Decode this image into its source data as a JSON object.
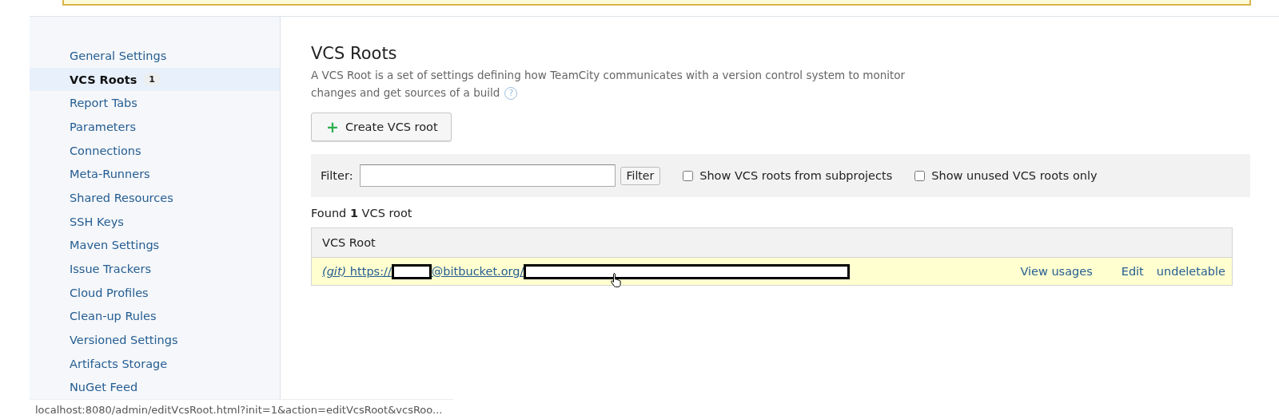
{
  "sidebar": {
    "items": [
      {
        "label": "General Settings",
        "selected": false
      },
      {
        "label": "VCS Roots",
        "selected": true,
        "count": "1"
      },
      {
        "label": "Report Tabs",
        "selected": false
      },
      {
        "label": "Parameters",
        "selected": false
      },
      {
        "label": "Connections",
        "selected": false
      },
      {
        "label": "Meta-Runners",
        "selected": false
      },
      {
        "label": "Shared Resources",
        "selected": false
      },
      {
        "label": "SSH Keys",
        "selected": false
      },
      {
        "label": "Maven Settings",
        "selected": false
      },
      {
        "label": "Issue Trackers",
        "selected": false
      },
      {
        "label": "Cloud Profiles",
        "selected": false
      },
      {
        "label": "Clean-up Rules",
        "selected": false
      },
      {
        "label": "Versioned Settings",
        "selected": false
      },
      {
        "label": "Artifacts Storage",
        "selected": false
      },
      {
        "label": "NuGet Feed",
        "selected": false
      }
    ]
  },
  "main": {
    "title": "VCS Roots",
    "description": "A VCS Root is a set of settings defining how TeamCity communicates with a version control system to monitor changes and get sources of a build",
    "help": "?",
    "create_button": {
      "icon": "+",
      "label": "Create VCS root"
    },
    "filter": {
      "label": "Filter:",
      "button": "Filter",
      "options": [
        {
          "label": "Show VCS roots from subprojects",
          "checked": false
        },
        {
          "label": "Show unused VCS roots only",
          "checked": false
        }
      ]
    },
    "found": "Found **1** VCS root",
    "table": {
      "columns": [
        "VCS Root"
      ],
      "rows": [
        {
          "type": "(git)",
          "url_parts": [
            "https://",
            "@bitbucket.org/"
          ],
          "actions": [
            "View usages",
            "Edit"
          ],
          "status": "undeletable"
        }
      ]
    }
  },
  "status_bar": {
    "url": "localhost:8080/admin/editVcsRoot.html?init=1&action=editVcsRoot&vcsRoo..."
  }
}
